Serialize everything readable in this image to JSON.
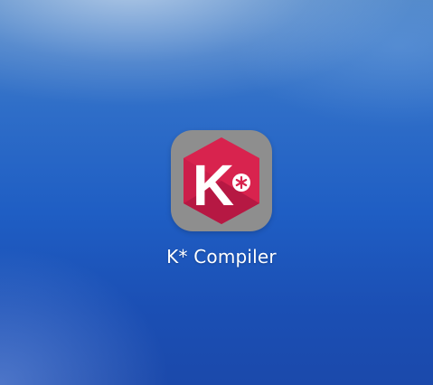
{
  "home_screen": {
    "app": {
      "name": "K* Compiler",
      "icon": "k-compiler-icon",
      "icon_letter": "K",
      "icon_colors": {
        "tile_background": "#8e8e8e",
        "hexagon_light": "#d8234e",
        "hexagon_dark": "#b01642",
        "glyph": "#ffffff"
      }
    }
  }
}
